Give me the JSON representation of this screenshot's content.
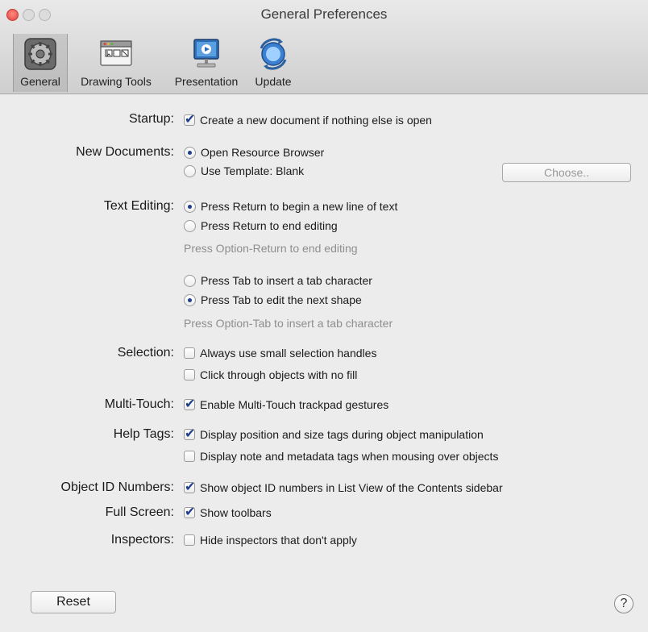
{
  "window": {
    "title": "General Preferences"
  },
  "toolbar": {
    "items": [
      {
        "label": "General",
        "icon": "gear-icon",
        "selected": true
      },
      {
        "label": "Drawing Tools",
        "icon": "drawing-tools-icon",
        "selected": false
      },
      {
        "label": "Presentation",
        "icon": "presentation-icon",
        "selected": false
      },
      {
        "label": "Update",
        "icon": "update-icon",
        "selected": false
      }
    ]
  },
  "labels": {
    "startup": "Startup:",
    "new_documents": "New Documents:",
    "text_editing": "Text Editing:",
    "selection": "Selection:",
    "multitouch": "Multi-Touch:",
    "help_tags": "Help Tags:",
    "object_id": "Object ID Numbers:",
    "full_screen": "Full Screen:",
    "inspectors": "Inspectors:"
  },
  "options": {
    "startup_new_doc": {
      "text": "Create a new document if nothing else is open",
      "checked": true
    },
    "open_resource_browser": {
      "text": "Open Resource Browser",
      "selected": true
    },
    "use_template": {
      "text": "Use Template: Blank",
      "selected": false
    },
    "return_new_line": {
      "text": "Press Return to begin a new line of text",
      "selected": true
    },
    "return_end_editing": {
      "text": "Press Return to end editing",
      "selected": false
    },
    "return_hint": "Press Option-Return to end editing",
    "tab_insert": {
      "text": "Press Tab to insert a tab character",
      "selected": false
    },
    "tab_next_shape": {
      "text": "Press Tab to edit the next shape",
      "selected": true
    },
    "tab_hint": "Press Option-Tab to insert a tab character",
    "small_handles": {
      "text": "Always use small selection handles",
      "checked": false
    },
    "click_through": {
      "text": "Click through objects with no fill",
      "checked": false
    },
    "multitouch_gestures": {
      "text": "Enable Multi-Touch trackpad gestures",
      "checked": true
    },
    "position_size_tags": {
      "text": "Display position and size tags during object manipulation",
      "checked": true
    },
    "note_metadata_tags": {
      "text": "Display note and metadata tags when mousing over objects",
      "checked": false
    },
    "object_id_numbers": {
      "text": "Show object ID numbers in List View of the Contents sidebar",
      "checked": true
    },
    "show_toolbars": {
      "text": "Show toolbars",
      "checked": true
    },
    "hide_inspectors": {
      "text": "Hide inspectors that don't apply",
      "checked": false
    }
  },
  "buttons": {
    "choose": "Choose..",
    "reset": "Reset",
    "help": "?"
  },
  "colors": {
    "accent": "#1f3f8a",
    "close_button": "#e0443e",
    "hint_text": "#8e8e8e"
  }
}
